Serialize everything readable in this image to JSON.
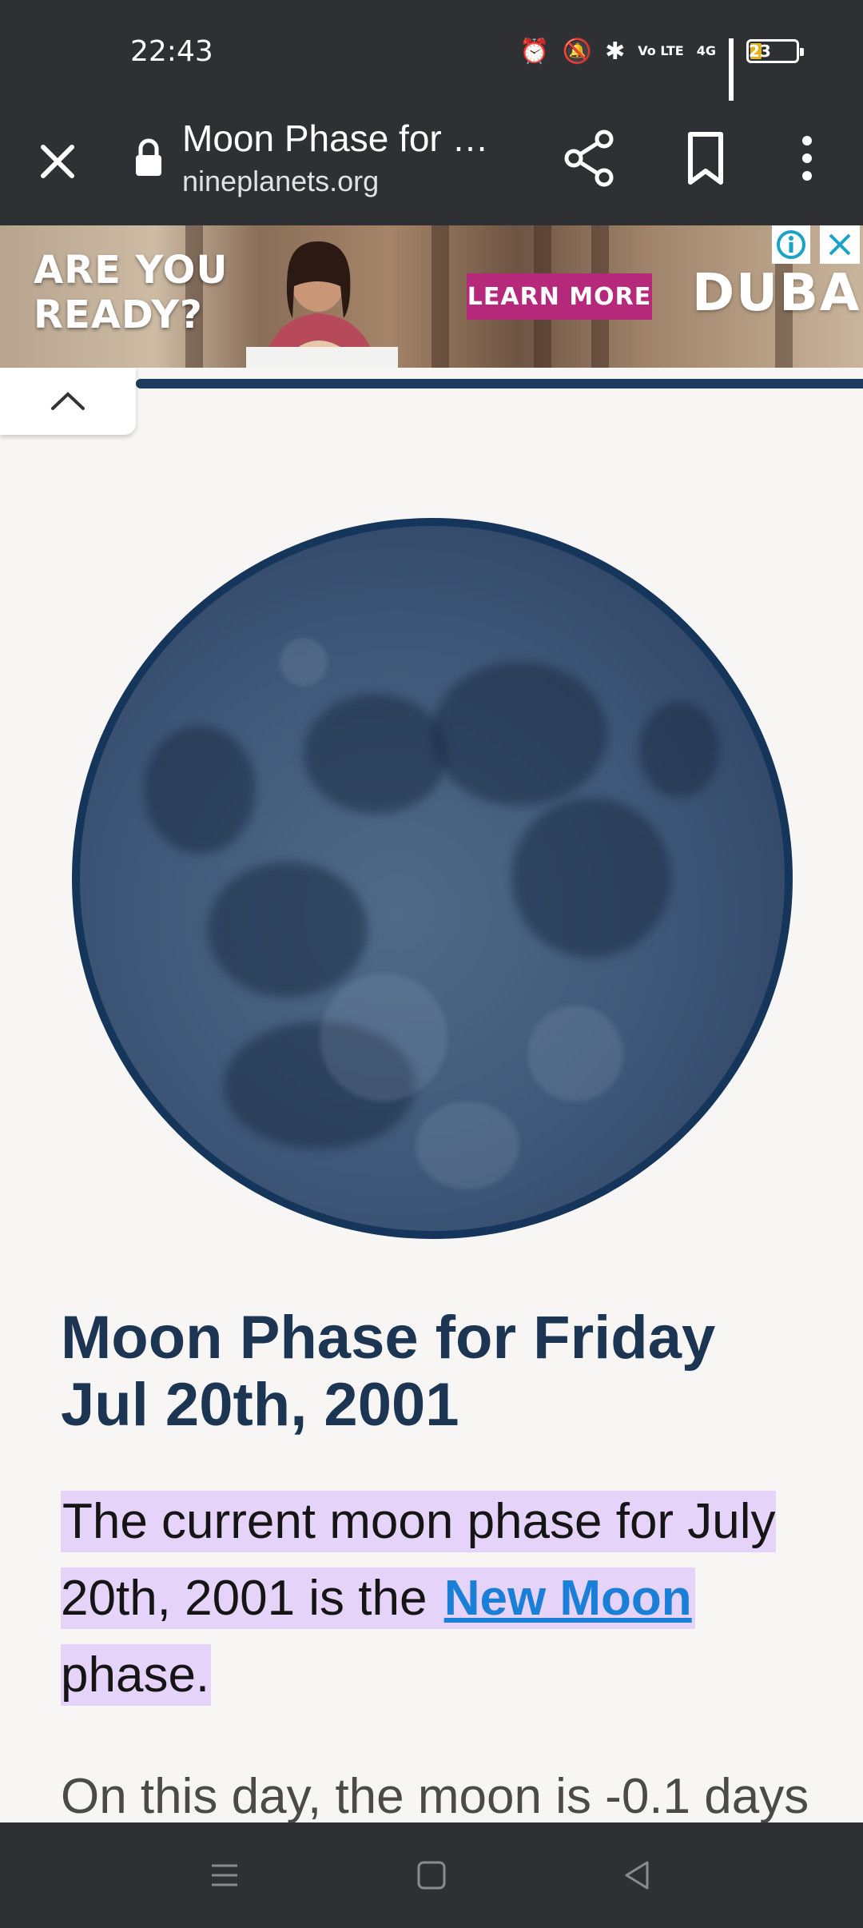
{
  "status_bar": {
    "time": "22:43",
    "network_tag": "Vo LTE",
    "network_type": "4G",
    "battery": "23"
  },
  "toolbar": {
    "title": "Moon Phase for …",
    "url": "nineplanets.org"
  },
  "ad": {
    "headline_line1": "ARE YOU",
    "headline_line2": "READY?",
    "cta": "LEARN MORE",
    "brand": "DUBAI"
  },
  "page": {
    "title": "Moon Phase for Friday Jul 20th, 2001",
    "intro_before": "The current moon phase for July 20th, 2001 is the ",
    "intro_link": "New Moon",
    "intro_after": " phase.",
    "para2_partial": "On this day, the moon is -0.1 days"
  },
  "colors": {
    "chrome": "#2f3033",
    "heading": "#1b3553",
    "highlight": "#e6d3fa",
    "link": "#1a7fd6",
    "moon_rim": "#15355a"
  },
  "icons": {
    "close": "close-icon",
    "lock": "lock-icon",
    "share": "share-icon",
    "bookmark": "bookmark-icon",
    "menu": "more-vertical-icon"
  }
}
